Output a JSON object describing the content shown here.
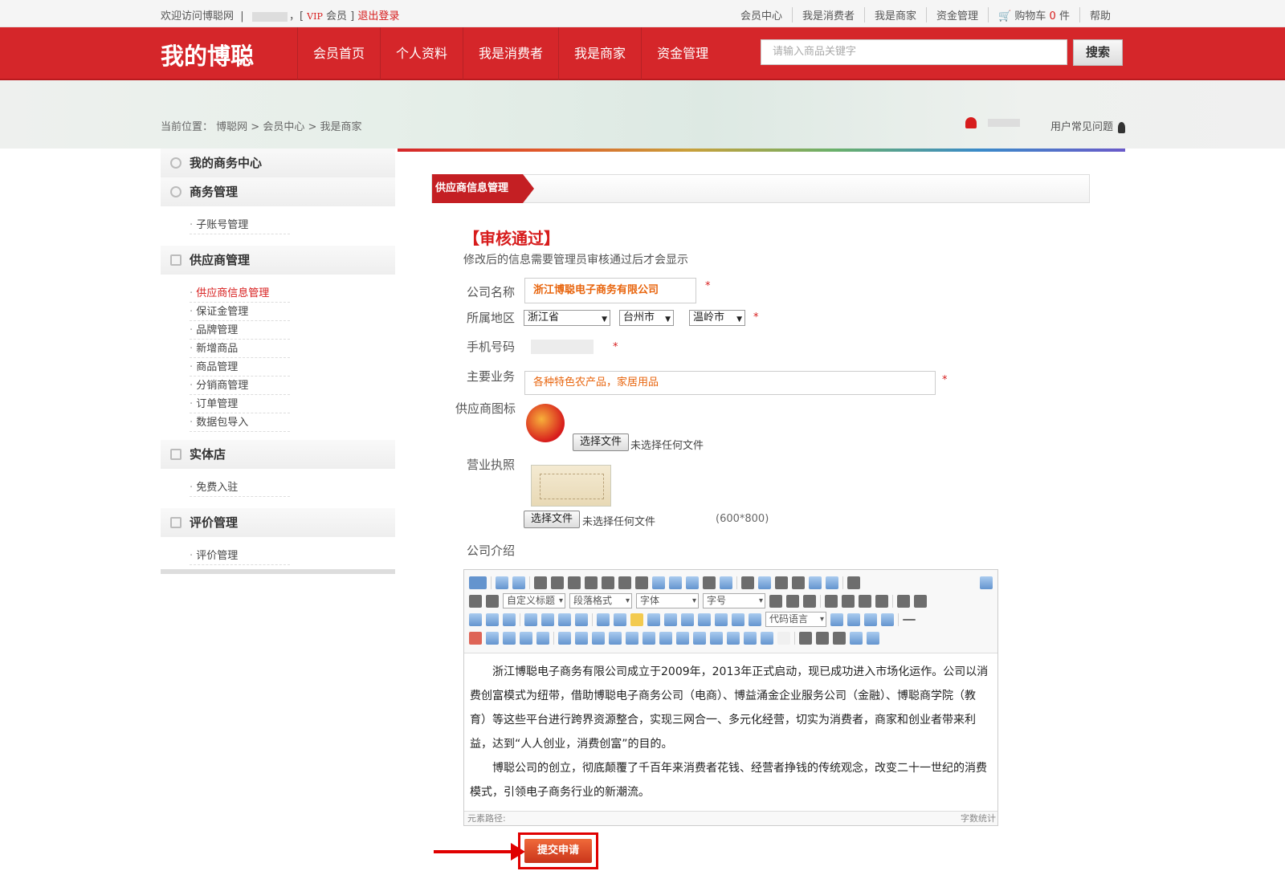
{
  "topbar": {
    "welcome": "欢迎访问博聪网",
    "bracket_open": "，[",
    "vip": "VIP",
    "member": "会员",
    "bracket_close": "]",
    "logout": "退出登录",
    "links": [
      "会员中心",
      "我是消费者",
      "我是商家",
      "资金管理"
    ],
    "cart_label": "购物车",
    "cart_count": "0",
    "cart_unit": "件",
    "help": "帮助"
  },
  "header": {
    "logo": "我的博聪",
    "nav": [
      "会员首页",
      "个人资料",
      "我是消费者",
      "我是商家",
      "资金管理"
    ],
    "search_placeholder": "请输入商品关键字",
    "search_button": "搜索"
  },
  "breadcrumb": {
    "label": "当前位置：",
    "items": [
      "博聪网",
      "会员中心",
      "我是商家"
    ]
  },
  "faq": "用户常见问题",
  "sidebar": {
    "sections": [
      {
        "title": "我的商务中心",
        "items": []
      },
      {
        "title": "商务管理",
        "items": [
          "子账号管理"
        ]
      },
      {
        "title": "供应商管理",
        "items": [
          "供应商信息管理",
          "保证金管理",
          "品牌管理",
          "新增商品",
          "商品管理",
          "分销商管理",
          "订单管理",
          "数据包导入"
        ]
      },
      {
        "title": "实体店",
        "items": [
          "免费入驻"
        ]
      },
      {
        "title": "评价管理",
        "items": [
          "评价管理"
        ]
      }
    ],
    "active_item": "供应商信息管理"
  },
  "main": {
    "tab": "供应商信息管理",
    "status": "【审核通过】",
    "note": "修改后的信息需要管理员审核通过后才会显示",
    "fields": {
      "company_label": "公司名称",
      "company_value": "浙江博聪电子商务有限公司",
      "region_label": "所属地区",
      "province": "浙江省",
      "city": "台州市",
      "district": "温岭市",
      "phone_label": "手机号码",
      "business_label": "主要业务",
      "business_value": "各种特色农产品，家居用品",
      "logo_label": "供应商图标",
      "license_label": "营业执照",
      "choose_file": "选择文件",
      "no_file": "未选择任何文件",
      "license_size": "(600*800)",
      "intro_label": "公司介绍",
      "required": "*"
    },
    "editor": {
      "custom_heading": "自定义标题",
      "paragraph_format": "段落格式",
      "font": "字体",
      "font_size": "字号",
      "code_lang": "代码语言",
      "para1": "浙江博聪电子商务有限公司成立于2009年，2013年正式启动，现已成功进入市场化运作。公司以消费创富模式为纽带，借助博聪电子商务公司（电商）、博益涌金企业服务公司（金融）、博聪商学院（教育）等这些平台进行跨界资源整合，实现三网合一、多元化经营，切实为消费者，商家和创业者带来利益，达到“人人创业，消费创富”的目的。",
      "para2": "博聪公司的创立，彻底颠覆了千百年来消费者花钱、经营者挣钱的传统观念，改变二十一世纪的消费模式，引领电子商务行业的新潮流。",
      "path_label": "元素路径:",
      "word_count": "字数统计"
    },
    "submit": "提交申请"
  }
}
